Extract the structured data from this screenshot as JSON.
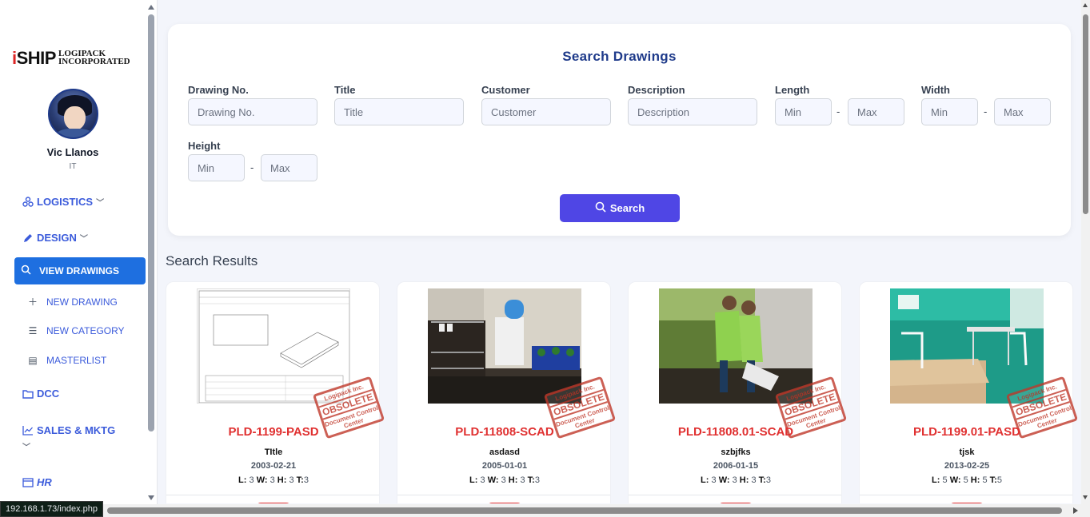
{
  "sidebar": {
    "logo": {
      "prefix": "i",
      "main": "SHIP",
      "line1": "LOGIPACK",
      "line2": "INCORPORATED"
    },
    "user": {
      "name": "Vic Llanos",
      "role": "IT"
    },
    "nav": {
      "logistics": "LOGISTICS",
      "design": "DESIGN",
      "view_drawings": "VIEW DRAWINGS",
      "new_drawing": "NEW DRAWING",
      "new_category": "NEW CATEGORY",
      "masterlist": "MASTERLIST",
      "dcc": "DCC",
      "sales": "SALES & MKTG",
      "hr": "HR"
    },
    "chevron": "﹀"
  },
  "search": {
    "title": "Search Drawings",
    "labels": {
      "drawing_no": "Drawing No.",
      "title": "Title",
      "customer": "Customer",
      "description": "Description",
      "length": "Length",
      "width": "Width",
      "height": "Height"
    },
    "placeholders": {
      "drawing_no": "Drawing No.",
      "title": "Title",
      "customer": "Customer",
      "description": "Description",
      "min": "Min",
      "max": "Max"
    },
    "dash": "-",
    "button": "Search"
  },
  "results": {
    "title": "Search Results",
    "stamp": {
      "top": "Logipack Inc.",
      "main": "OBSOLETE",
      "bottom": "Document Control Center"
    },
    "cards": [
      {
        "code": "PLD-1199-PASD",
        "title": "TItle",
        "date": "2003-02-21",
        "L": "3",
        "W": "3",
        "H": "3",
        "T": "3",
        "thumb": "technical-drawing"
      },
      {
        "code": "PLD-11808-SCAD",
        "title": "asdasd",
        "date": "2005-01-01",
        "L": "3",
        "W": "3",
        "H": "3",
        "T": "3",
        "thumb": "photo-shelf"
      },
      {
        "code": "PLD-11808.01-SCAD",
        "title": "szbjfks",
        "date": "2006-01-15",
        "L": "3",
        "W": "3",
        "H": "3",
        "T": "3",
        "thumb": "photo-people"
      },
      {
        "code": "PLD-1199.01-PASD",
        "title": "tjsk",
        "date": "2013-02-25",
        "L": "5",
        "W": "5",
        "H": "5",
        "T": "5",
        "thumb": "photo-room"
      }
    ],
    "dim_labels": {
      "L": "L:",
      "W": "W:",
      "H": "H:",
      "T": "T:"
    }
  },
  "status_bar": {
    "url": "192.168.1.73/index.php"
  },
  "colors": {
    "accent": "#4f46e5",
    "nav_active": "#1e6fe0",
    "code_red": "#e03131",
    "title_blue": "#1e3a8a"
  }
}
